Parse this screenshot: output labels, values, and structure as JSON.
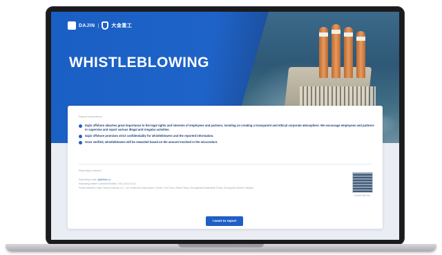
{
  "header": {
    "brand_en": "DAJIN",
    "brand_sep": "|",
    "brand_cn": "大金重工"
  },
  "hero": {
    "title": "WHISTLEBLOWING"
  },
  "card": {
    "section1_label": "Report Instructions",
    "bullets": [
      "Dajin offshore attaches great importance to the legal rights and interests of employees and partners, insisting on creating a transparent and ethical corporate atmosphere. We encourage employees and partners to supervise and report various illegal and irregular activities.",
      "Dajin offshore promises strict confidentiality for whistleblowers and the reported information.",
      "Once verified, whistleblowers will be rewarded based on the amount involved in the misconduct."
    ],
    "section2_label": "Reporting channel",
    "email_label": "Reporting email:",
    "email_value": "dj@dhwl.cn",
    "hotline_text": "Reporting hotline: Landline/Mobile / 0411-0411-0411",
    "address_text": "Postal address: Dajin Heavy Industry Co., Ltd. Audit and Supervision Center, 11th Floor, Asian Plaza, Zhongshan/Dalianshan Road, Zhongshan District, Beijing",
    "qr_label": "Contact WeChat",
    "report_button": "I want to report"
  }
}
